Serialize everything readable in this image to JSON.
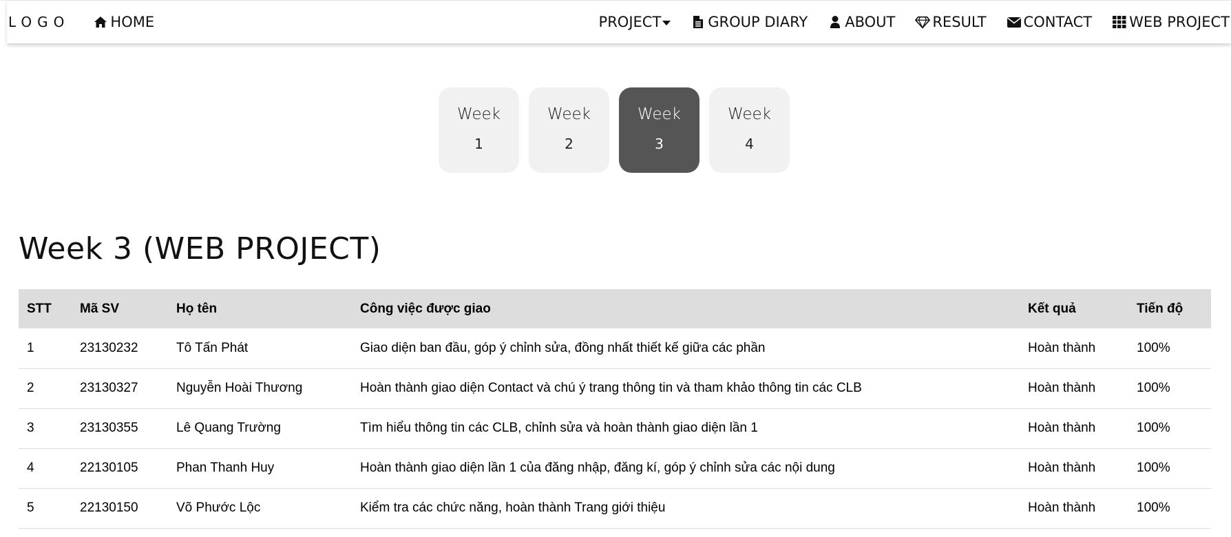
{
  "nav": {
    "logo": "LOGO",
    "home": "HOME",
    "items": [
      {
        "label": "PROJECT",
        "icon": "caret-down-icon"
      },
      {
        "label": "GROUP DIARY",
        "icon": "file-icon"
      },
      {
        "label": "ABOUT",
        "icon": "user-icon"
      },
      {
        "label": "RESULT",
        "icon": "diamond-icon"
      },
      {
        "label": "CONTACT",
        "icon": "envelope-icon"
      },
      {
        "label": "WEB PROJECT",
        "icon": "grid-icon"
      }
    ]
  },
  "weeks": [
    {
      "label": "Week",
      "num": "1",
      "active": false
    },
    {
      "label": "Week",
      "num": "2",
      "active": false
    },
    {
      "label": "Week",
      "num": "3",
      "active": true
    },
    {
      "label": "Week",
      "num": "4",
      "active": false
    }
  ],
  "page_title": "Week 3 (WEB PROJECT)",
  "table": {
    "headers": [
      "STT",
      "Mã SV",
      "Họ tên",
      "Công việc được giao",
      "Kết quả",
      "Tiến độ"
    ],
    "rows": [
      [
        "1",
        "23130232",
        "Tô Tấn Phát",
        "Giao diện ban đầu, góp ý chỉnh sửa, đồng nhất thiết kế giữa các phần",
        "Hoàn thành",
        "100%"
      ],
      [
        "2",
        "23130327",
        "Nguyễn Hoài Thương",
        "Hoàn thành giao diện Contact và chú ý trang thông tin và tham khảo thông tin các CLB",
        "Hoàn thành",
        "100%"
      ],
      [
        "3",
        "23130355",
        "Lê Quang Trường",
        "Tìm hiểu thông tin các CLB, chỉnh sửa và hoàn thành giao diện lần 1",
        "Hoàn thành",
        "100%"
      ],
      [
        "4",
        "22130105",
        "Phan Thanh Huy",
        "Hoàn thành giao diện lần 1 của đăng nhập, đăng kí, góp ý chỉnh sửa các nội dung",
        "Hoàn thành",
        "100%"
      ],
      [
        "5",
        "22130150",
        "Võ Phước Lộc",
        "Kiểm tra các chức năng, hoàn thành Trang giới thiệu",
        "Hoàn thành",
        "100%"
      ]
    ]
  },
  "colors": {
    "active_week": "#555555",
    "inactive_week": "#f1f1f1",
    "table_header": "#dddddd"
  }
}
